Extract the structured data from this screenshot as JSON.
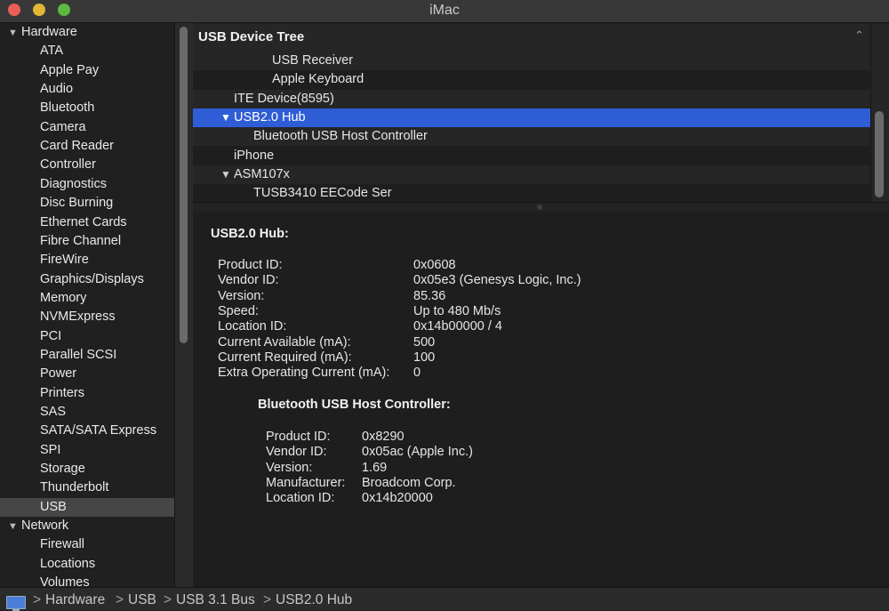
{
  "window": {
    "title": "iMac"
  },
  "sidebar": {
    "hardware_label": "Hardware",
    "hardware_items": [
      "ATA",
      "Apple Pay",
      "Audio",
      "Bluetooth",
      "Camera",
      "Card Reader",
      "Controller",
      "Diagnostics",
      "Disc Burning",
      "Ethernet Cards",
      "Fibre Channel",
      "FireWire",
      "Graphics/Displays",
      "Memory",
      "NVMExpress",
      "PCI",
      "Parallel SCSI",
      "Power",
      "Printers",
      "SAS",
      "SATA/SATA Express",
      "SPI",
      "Storage",
      "Thunderbolt",
      "USB"
    ],
    "selected_item": "USB",
    "network_label": "Network",
    "network_items": [
      "Firewall",
      "Locations",
      "Volumes"
    ]
  },
  "tree": {
    "header": "USB Device Tree",
    "rows": [
      {
        "label": "USB Receiver",
        "level": 3,
        "expandable": false,
        "selected": false
      },
      {
        "label": "Apple Keyboard",
        "level": 3,
        "expandable": false,
        "selected": false
      },
      {
        "label": "ITE Device(8595)",
        "level": 1,
        "expandable": false,
        "selected": false
      },
      {
        "label": "USB2.0 Hub",
        "level": 1,
        "expandable": true,
        "selected": true
      },
      {
        "label": "Bluetooth USB Host Controller",
        "level": 2,
        "expandable": false,
        "selected": false
      },
      {
        "label": "iPhone",
        "level": 1,
        "expandable": false,
        "selected": false
      },
      {
        "label": "ASM107x",
        "level": 1,
        "expandable": true,
        "selected": false
      },
      {
        "label": "TUSB3410 EECode Ser",
        "level": 2,
        "expandable": false,
        "selected": false
      }
    ]
  },
  "detail": {
    "title": "USB2.0 Hub:",
    "properties": [
      {
        "key": "Product ID:",
        "value": "0x0608"
      },
      {
        "key": "Vendor ID:",
        "value": "0x05e3  (Genesys Logic, Inc.)"
      },
      {
        "key": "Version:",
        "value": "85.36"
      },
      {
        "key": "Speed:",
        "value": "Up to 480 Mb/s"
      },
      {
        "key": "Location ID:",
        "value": "0x14b00000 / 4"
      },
      {
        "key": "Current Available (mA):",
        "value": "500"
      },
      {
        "key": "Current Required (mA):",
        "value": "100"
      },
      {
        "key": "Extra Operating Current (mA):",
        "value": "0"
      }
    ],
    "child": {
      "title": "Bluetooth USB Host Controller:",
      "properties": [
        {
          "key": "Product ID:",
          "value": "0x8290"
        },
        {
          "key": "Vendor ID:",
          "value": "0x05ac (Apple Inc.)"
        },
        {
          "key": "Version:",
          "value": "1.69"
        },
        {
          "key": "Manufacturer:",
          "value": "Broadcom Corp."
        },
        {
          "key": "Location ID:",
          "value": "0x14b20000"
        }
      ]
    }
  },
  "pathbar": {
    "crumbs": [
      "Hardware",
      "USB",
      "USB 3.1 Bus",
      "USB2.0 Hub"
    ],
    "separator": ">",
    "icon": "imac-icon"
  }
}
